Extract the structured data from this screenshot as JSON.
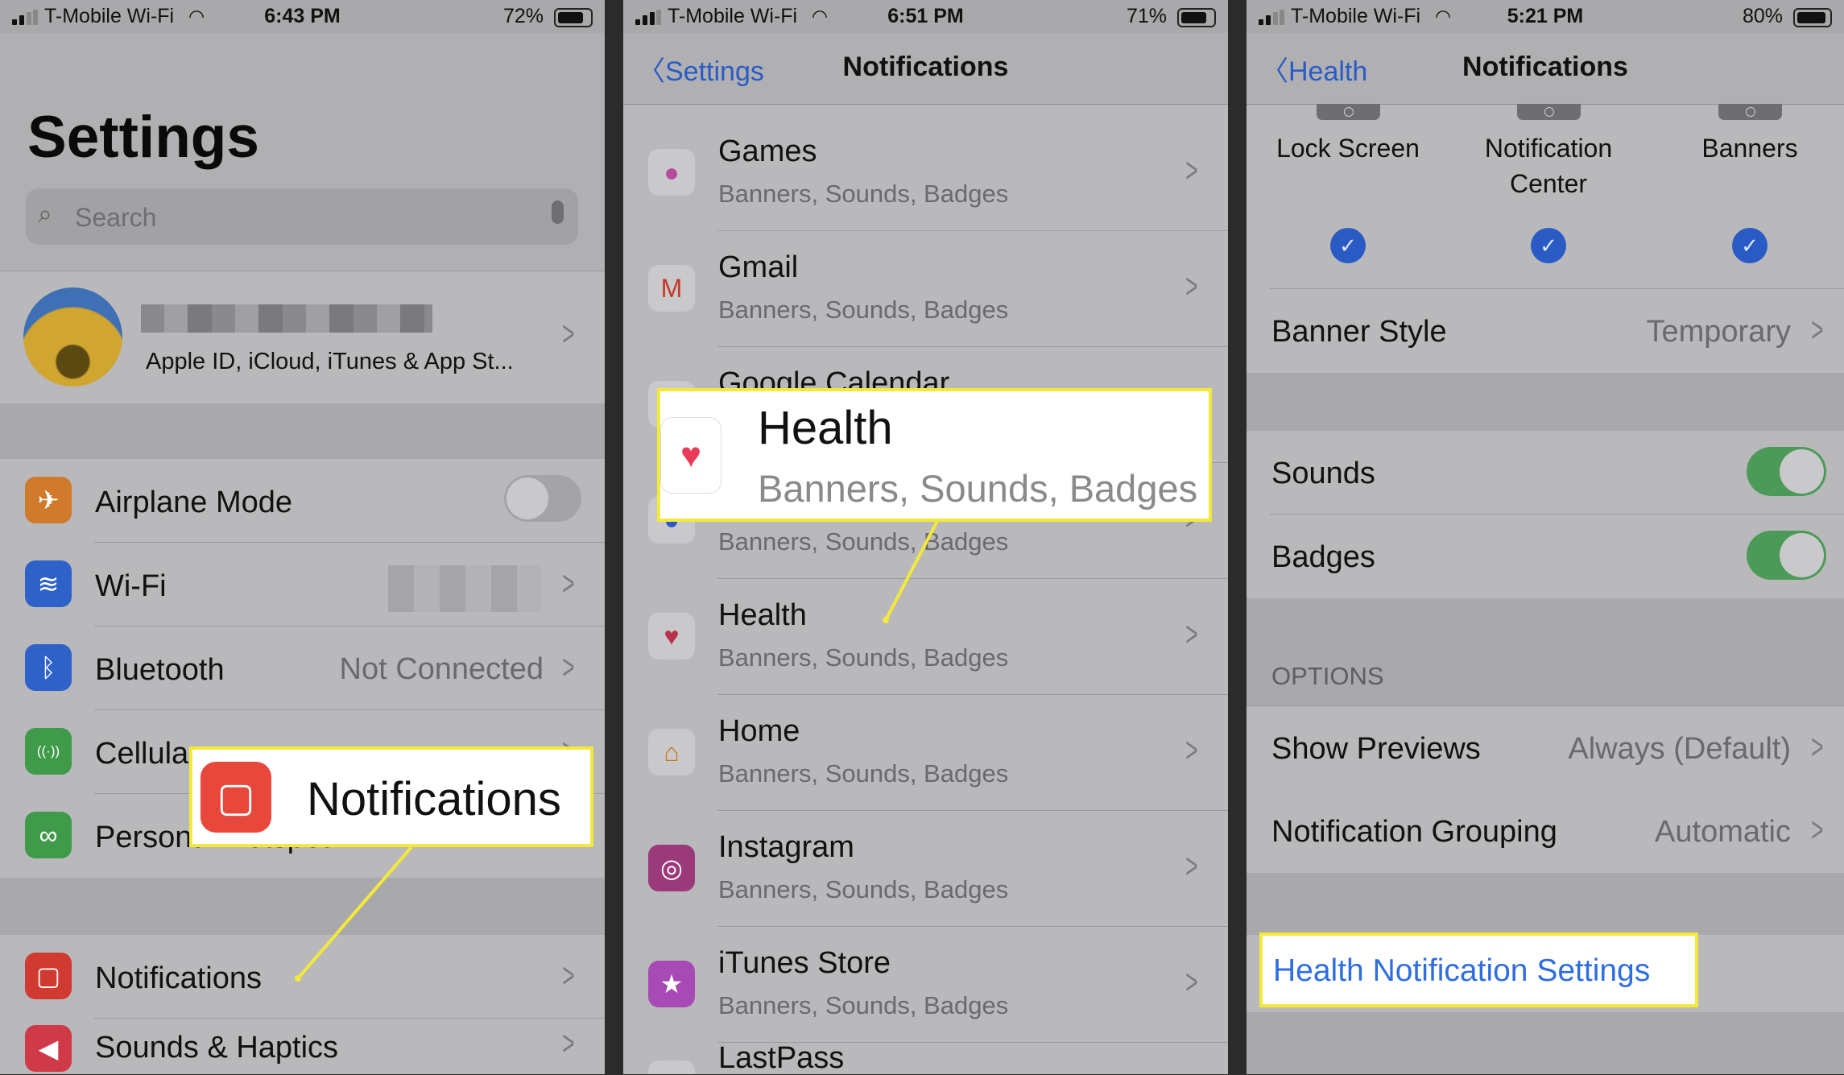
{
  "colors": {
    "accent_blue": "#2a5bc4",
    "highlight_yellow": "#f3e93a",
    "toggle_green": "#4c9a58"
  },
  "panel1": {
    "status": {
      "carrier": "T-Mobile Wi-Fi",
      "time": "6:43 PM",
      "battery": "72%"
    },
    "title": "Settings",
    "search": {
      "placeholder": "Search"
    },
    "profile": {
      "subtitle": "Apple ID, iCloud, iTunes & App St..."
    },
    "group1": [
      {
        "label": "Airplane Mode",
        "icon": "airplane-icon",
        "color": "#d07a2c",
        "glyph": "✈",
        "toggle": false
      },
      {
        "label": "Wi-Fi",
        "icon": "wifi-icon",
        "color": "#2f62c8",
        "glyph": "≋",
        "value": ""
      },
      {
        "label": "Bluetooth",
        "icon": "bluetooth-icon",
        "color": "#2f62c8",
        "glyph": "ᛒ",
        "value": "Not Connected"
      },
      {
        "label": "Cellular",
        "icon": "cellular-icon",
        "color": "#3f9a4a",
        "glyph": "((·))",
        "value": ""
      },
      {
        "label": "Personal Hotspot",
        "icon": "hotspot-icon",
        "color": "#3f9a4a",
        "glyph": "∞",
        "value": ""
      }
    ],
    "group2": [
      {
        "label": "Notifications",
        "icon": "notifications-icon",
        "color": "#d03a30",
        "glyph": "▢"
      },
      {
        "label": "Sounds & Haptics",
        "icon": "sounds-icon",
        "color": "#d03a48",
        "glyph": "◀"
      }
    ],
    "callout": {
      "label": "Notifications"
    }
  },
  "panel2": {
    "status": {
      "carrier": "T-Mobile Wi-Fi",
      "time": "6:51 PM",
      "battery": "71%"
    },
    "back": "Settings",
    "title": "Notifications",
    "apps": [
      {
        "name": "Games",
        "sub": "Banners, Sounds, Badges",
        "icon": "game-center-icon",
        "color": "#c9c9cc",
        "glyph": "●",
        "gcolor": "#b54a9c"
      },
      {
        "name": "Gmail",
        "sub": "Banners, Sounds, Badges",
        "icon": "gmail-icon",
        "color": "#c9c9cc",
        "glyph": "M",
        "gcolor": "#c0392b"
      },
      {
        "name": "Google Calendar",
        "sub": "",
        "icon": "google-calendar-icon",
        "color": "#c9c9cc",
        "glyph": "",
        "gcolor": "#2a5bc4"
      },
      {
        "name": "",
        "sub": "Banners, Sounds, Badges",
        "icon": "google-app-icon",
        "color": "#c9c9cc",
        "glyph": "◕",
        "gcolor": "#2a5bc4"
      },
      {
        "name": "Health",
        "sub": "Banners, Sounds, Badges",
        "icon": "heart-icon",
        "color": "#c9c9cc",
        "glyph": "♥",
        "gcolor": "#b8324c"
      },
      {
        "name": "Home",
        "sub": "Banners, Sounds, Badges",
        "icon": "home-icon",
        "color": "#c9c9cc",
        "glyph": "⌂",
        "gcolor": "#c9761e"
      },
      {
        "name": "Instagram",
        "sub": "Banners, Sounds, Badges",
        "icon": "instagram-icon",
        "color": "#9a3a7a",
        "glyph": "◎",
        "gcolor": "#fff"
      },
      {
        "name": "iTunes Store",
        "sub": "Banners, Sounds, Badges",
        "icon": "itunes-star-icon",
        "color": "#a84ab5",
        "glyph": "★",
        "gcolor": "#fff"
      },
      {
        "name": "LastPass",
        "sub": "",
        "icon": "lastpass-icon",
        "color": "#c9c9cc",
        "glyph": "",
        "gcolor": "#fff"
      }
    ],
    "callout": {
      "name": "Health",
      "sub": "Banners, Sounds, Badges"
    }
  },
  "panel3": {
    "status": {
      "carrier": "T-Mobile Wi-Fi",
      "time": "5:21 PM",
      "battery": "80%"
    },
    "back": "Health",
    "title": "Notifications",
    "alerts": [
      {
        "label": "Lock Screen",
        "checked": true
      },
      {
        "label": "Notification Center",
        "checked": true
      },
      {
        "label": "Banners",
        "checked": true
      }
    ],
    "banner_style": {
      "label": "Banner Style",
      "value": "Temporary"
    },
    "sounds": {
      "label": "Sounds",
      "on": true
    },
    "badges": {
      "label": "Badges",
      "on": true
    },
    "options_header": "OPTIONS",
    "show_previews": {
      "label": "Show Previews",
      "value": "Always (Default)"
    },
    "grouping": {
      "label": "Notification Grouping",
      "value": "Automatic"
    },
    "link": "Health Notification Settings"
  }
}
